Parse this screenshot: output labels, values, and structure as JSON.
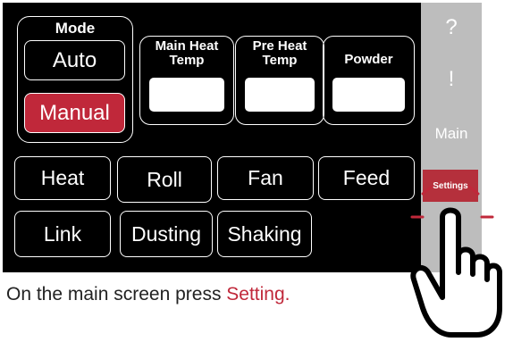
{
  "mode_panel": {
    "title": "Mode",
    "auto_label": "Auto",
    "manual_label": "Manual"
  },
  "params": [
    {
      "title_line1": "Main Heat",
      "title_line2": "Temp",
      "value": ""
    },
    {
      "title_line1": "Pre Heat",
      "title_line2": "Temp",
      "value": ""
    },
    {
      "title_line1": "Powder",
      "title_line2": "",
      "value": ""
    }
  ],
  "function_buttons": {
    "heat": "Heat",
    "roll": "Roll",
    "fan": "Fan",
    "feed": "Feed",
    "link": "Link",
    "dusting": "Dusting",
    "shaking": "Shaking"
  },
  "sidebar": {
    "help": "?",
    "alarm": "!",
    "main": "Main",
    "settings": "Settings",
    "bottom": "I"
  },
  "caption": {
    "prefix": "On the main screen press ",
    "highlight": "Setting."
  },
  "colors": {
    "screen_bg": "#000000",
    "active_red": "#c0283a",
    "sidebar_bg": "#bdbdbd",
    "settings_red": "#b5303c"
  }
}
